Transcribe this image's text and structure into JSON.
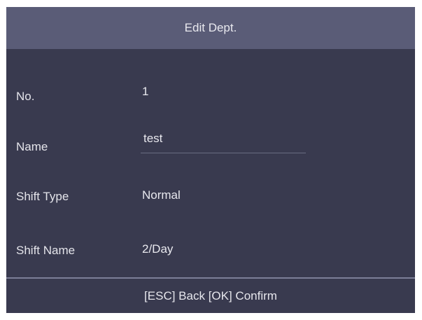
{
  "header": {
    "title": "Edit Dept."
  },
  "form": {
    "no": {
      "label": "No.",
      "value": "1"
    },
    "name": {
      "label": "Name",
      "value": "test"
    },
    "shift_type": {
      "label": "Shift Type",
      "value": "Normal"
    },
    "shift_name": {
      "label": "Shift Name",
      "value": "2/Day"
    }
  },
  "footer": {
    "hint": "[ESC] Back [OK] Confirm"
  },
  "colors": {
    "background": "#393a4f",
    "title_bar": "#5a5c77",
    "text": "#e8e8ee"
  }
}
